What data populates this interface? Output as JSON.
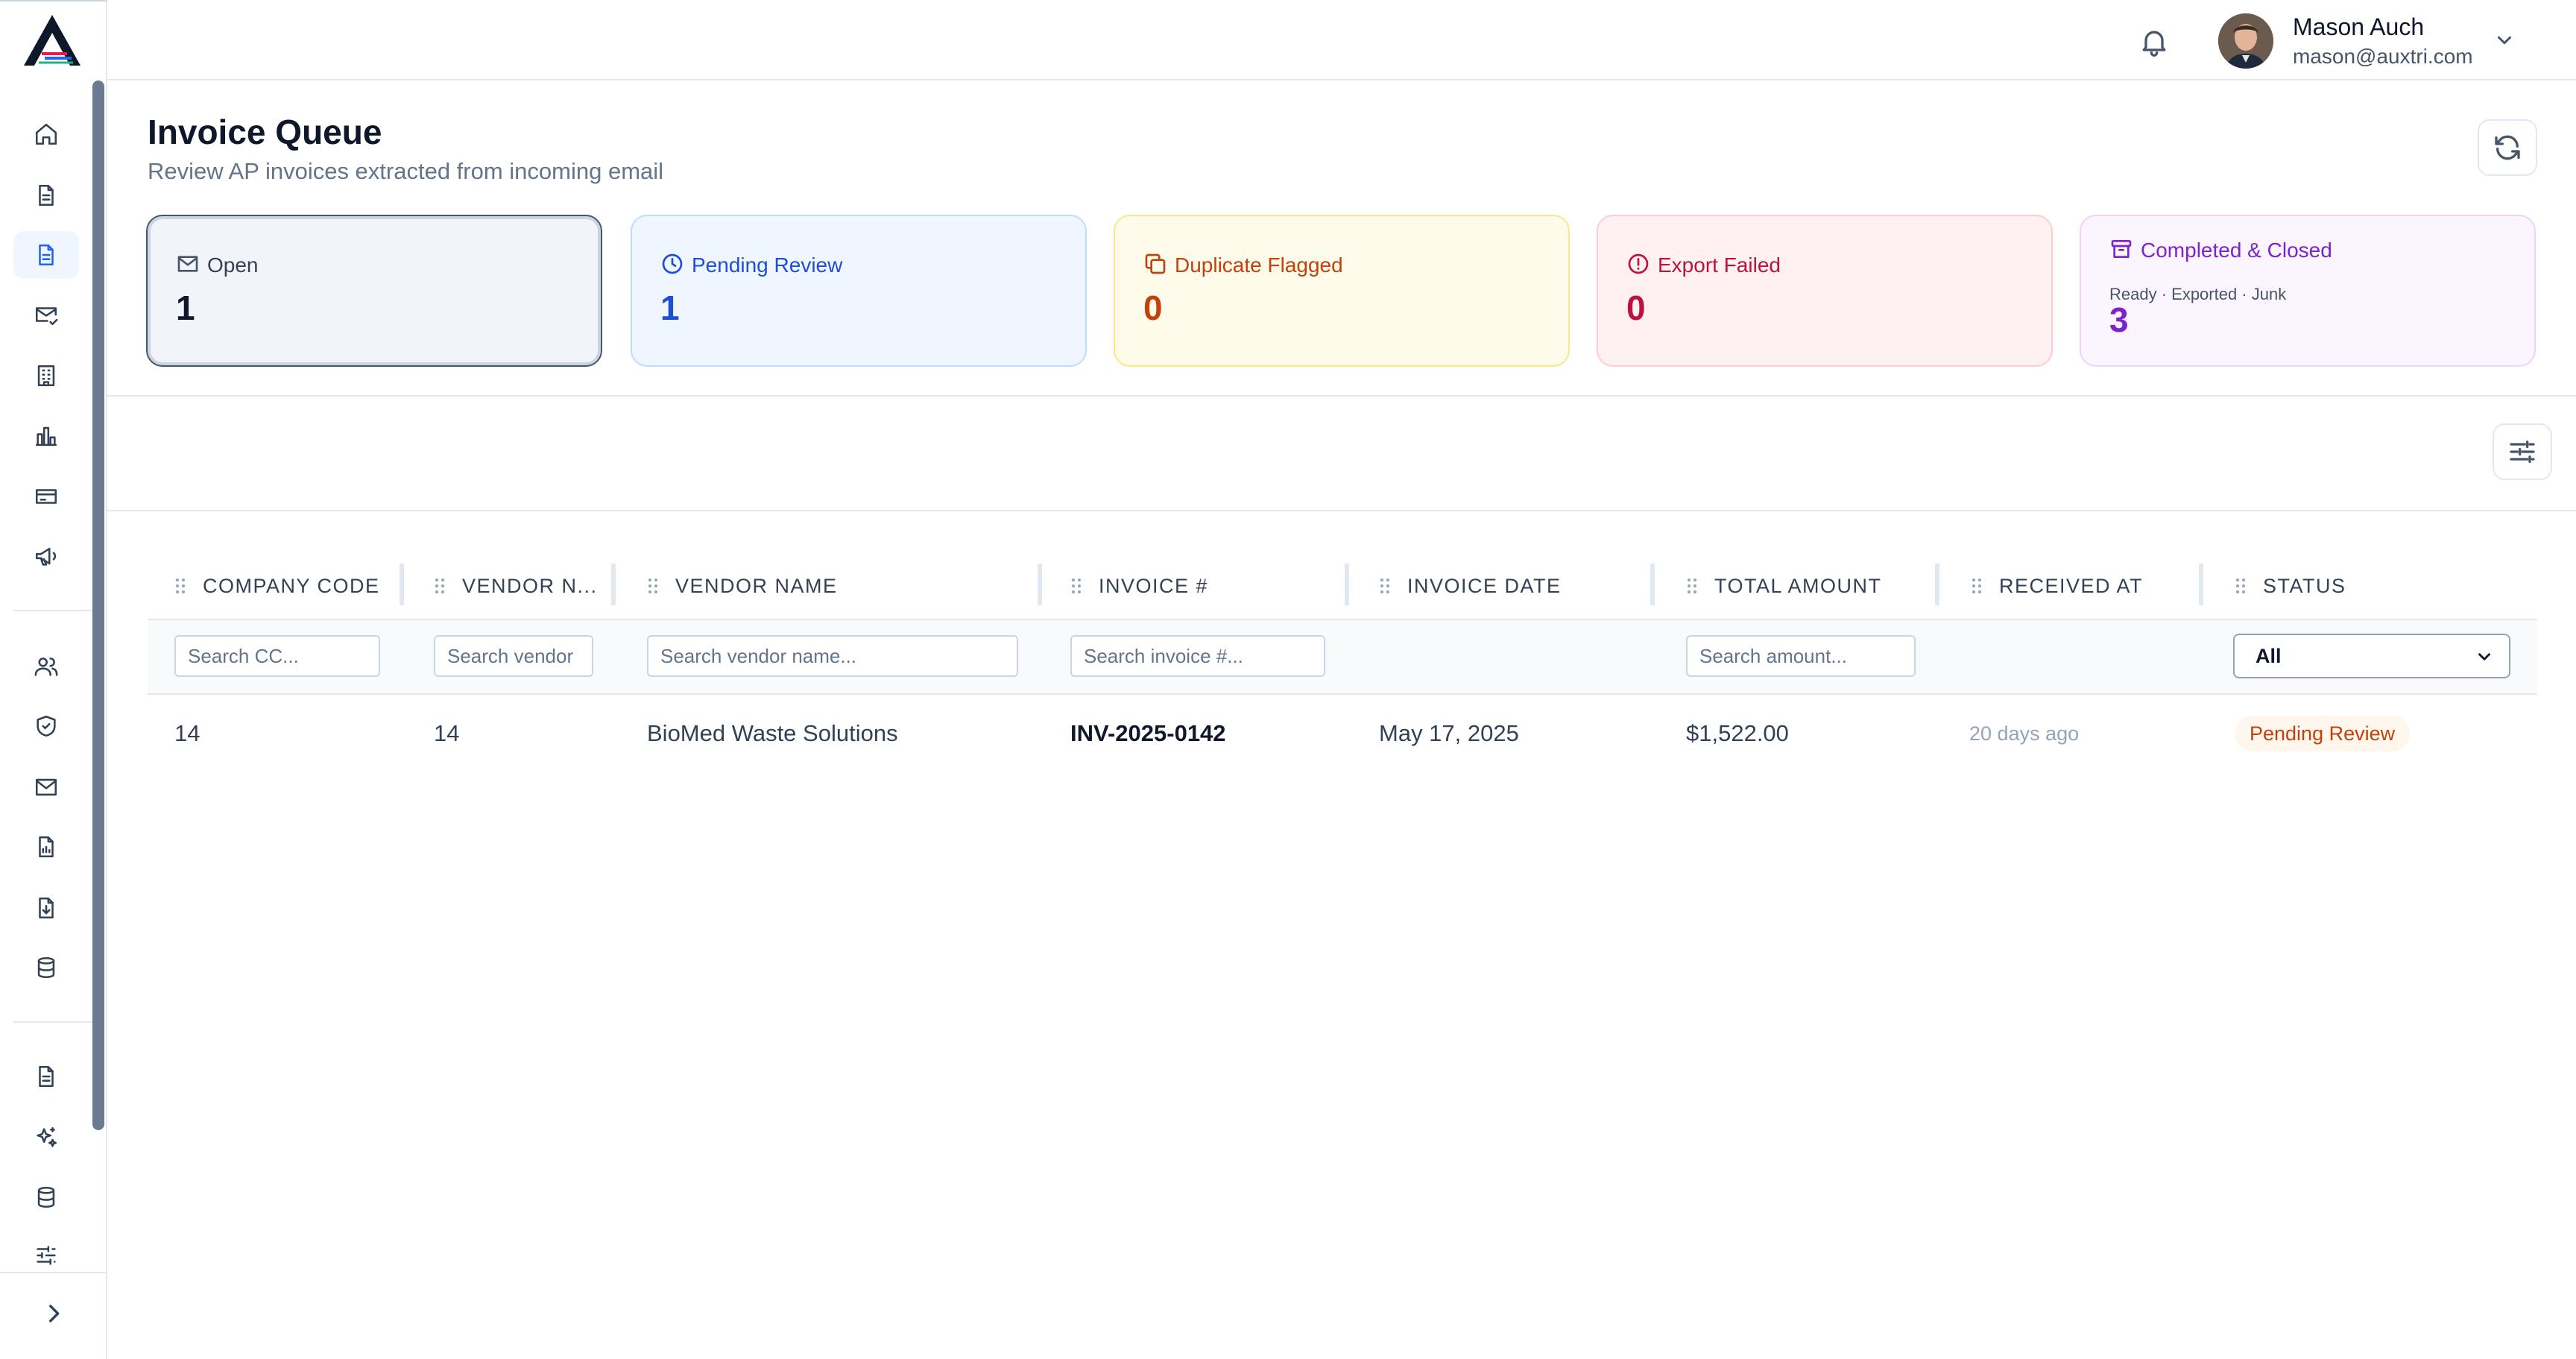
{
  "user": {
    "name": "Mason Auch",
    "email": "mason@auxtri.com"
  },
  "sidebar": {
    "icons": [
      "home-icon",
      "document-icon",
      "document-icon",
      "mail-check-icon",
      "building-icon",
      "bar-chart-icon",
      "credit-card-icon",
      "megaphone-icon",
      "users-icon",
      "shield-check-icon",
      "mail-icon",
      "file-chart-icon",
      "file-download-icon",
      "database-icon",
      "document-icon",
      "sparkles-icon",
      "database-icon",
      "sliders-icon"
    ],
    "active_index": 2
  },
  "header": {
    "title": "Invoice Queue",
    "subtitle": "Review AP invoices extracted from incoming email"
  },
  "cards": {
    "open": {
      "label": "Open",
      "value": "1"
    },
    "pending": {
      "label": "Pending Review",
      "value": "1"
    },
    "duplicate": {
      "label": "Duplicate Flagged",
      "value": "0"
    },
    "failed": {
      "label": "Export Failed",
      "value": "0"
    },
    "completed": {
      "label": "Completed & Closed",
      "sub": "Ready · Exported · Junk",
      "value": "3"
    }
  },
  "table": {
    "columns": [
      "COMPANY CODE",
      "VENDOR N...",
      "VENDOR NAME",
      "INVOICE #",
      "INVOICE DATE",
      "TOTAL AMOUNT",
      "RECEIVED AT",
      "STATUS"
    ],
    "filters": {
      "company_code": "Search CC...",
      "vendor_number": "Search vendor",
      "vendor_name": "Search vendor name...",
      "invoice": "Search invoice #...",
      "amount": "Search amount...",
      "status": "All"
    },
    "rows": [
      {
        "company_code": "14",
        "vendor_number": "14",
        "vendor_name": "BioMed Waste Solutions",
        "invoice": "INV-2025-0142",
        "invoice_date": "May 17, 2025",
        "total_amount": "$1,522.00",
        "received_at": "20 days ago",
        "status": "Pending Review"
      }
    ]
  },
  "colors": {
    "accent": "#2563eb",
    "pending": "#1d4ed8",
    "duplicate": "#c2410c",
    "failed": "#be123c",
    "completed": "#7e22ce"
  }
}
